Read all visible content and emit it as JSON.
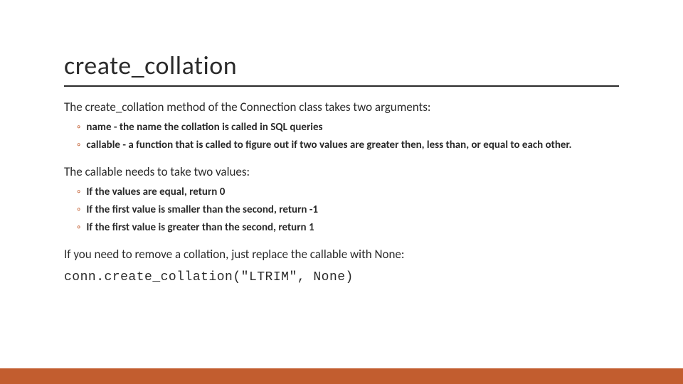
{
  "title": "create_collation",
  "intro": "The create_collation method of the Connection class takes two arguments:",
  "args": [
    "name - the name the collation is called in SQL queries",
    "callable - a function that is called to figure out if two values are greater then, less than, or equal to each other."
  ],
  "callable_intro": "The callable needs to take two values:",
  "callable_rules": [
    "If the values are equal, return 0",
    "If the first value is smaller than the second, return -1",
    "If the first value is greater than the second, return 1"
  ],
  "remove_text": "If you need to remove a collation, just replace the callable with None:",
  "code_example": "conn.create_collation(\"LTRIM\", None)",
  "bullet_marker": "◦"
}
